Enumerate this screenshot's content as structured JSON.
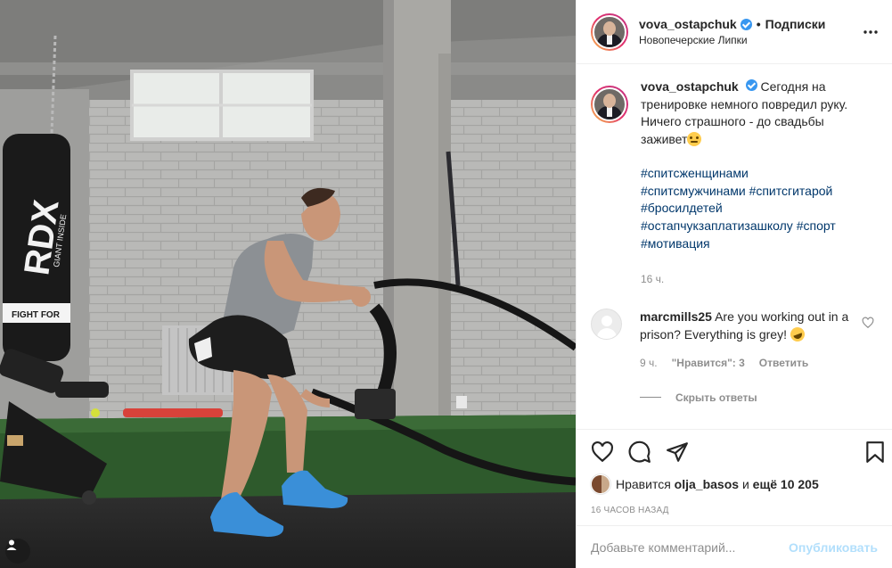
{
  "post": {
    "username": "vova_ostapchuk",
    "follow_label": "Подписки",
    "location": "Новопечерские Липки"
  },
  "caption": {
    "text": "Сегодня на тренировке немного повредил руку. Ничего страшного - до свадьбы заживет",
    "hashtags": [
      "#спитсженщинами",
      "#спитсмужчинами",
      "#спитсгитарой",
      "#бросилдетей",
      "#остапчукзаплатизашколу",
      "#спорт",
      "#мотивация"
    ],
    "time": "16 ч."
  },
  "comment": {
    "username": "marcmills25",
    "text": "Are you working out in a prison? Everything is grey!",
    "time": "9 ч.",
    "likes_label": "\"Нравится\": 3",
    "reply_label": "Ответить",
    "hide_replies_label": "Скрыть ответы"
  },
  "likes": {
    "prefix": "Нравится",
    "user": "olja_basos",
    "middle": "и",
    "count": "ещё 10 205"
  },
  "timestamp": "16 ЧАСОВ НАЗАД",
  "add_comment": {
    "placeholder": "Добавьте комментарий...",
    "post_label": "Опубликовать"
  },
  "photo": {
    "bag_brand": "RDX",
    "bag_subtitle": "GIANT INSIDE",
    "bag_slogan": "FIGHT FOR"
  },
  "colors": {
    "link": "#00376b",
    "verified": "#3897f0",
    "publish_disabled": "#b2dffc",
    "meta_gray": "#8e8e8e"
  },
  "icons": [
    "more-icon",
    "verified-icon",
    "heart-icon",
    "comment-icon",
    "share-icon",
    "bookmark-icon",
    "user-tag-icon"
  ]
}
